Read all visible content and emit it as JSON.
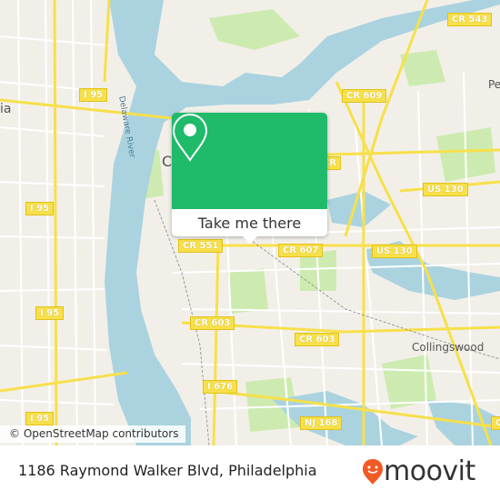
{
  "map": {
    "labels": {
      "i95_a": "I 95",
      "i95_b": "I 95",
      "i95_c": "I 95",
      "i95_d": "I 95",
      "cr543": "CR 543",
      "cr609": "CR 609",
      "us130_a": "US 130",
      "us130_b": "US 130",
      "cr551": "CR 551",
      "cr607": "CR 607",
      "cr603_a": "CR 603",
      "cr603_b": "CR 603",
      "i676": "I 676",
      "nj168": "NJ 168",
      "c_edge": "C",
      "c_top": "CR",
      "collingswood": "Collingswood",
      "pe": "Pe",
      "phila": "ia",
      "camden": "C",
      "river": "Delaware River"
    },
    "colors": {
      "water": "#aad3df",
      "park": "#cdebb0",
      "road_major": "#f7e04a",
      "land": "#f2efe9",
      "accent": "#1fba6a"
    },
    "attribution": "© OpenStreetMap contributors"
  },
  "popup": {
    "icon": "location-pin-icon",
    "button_label": "Take me there"
  },
  "footer": {
    "address": "1186 Raymond Walker Blvd, Philadelphia",
    "logo_text": "moovit",
    "logo_icon": "moovit-pin-icon",
    "logo_color": "#f15a24"
  }
}
